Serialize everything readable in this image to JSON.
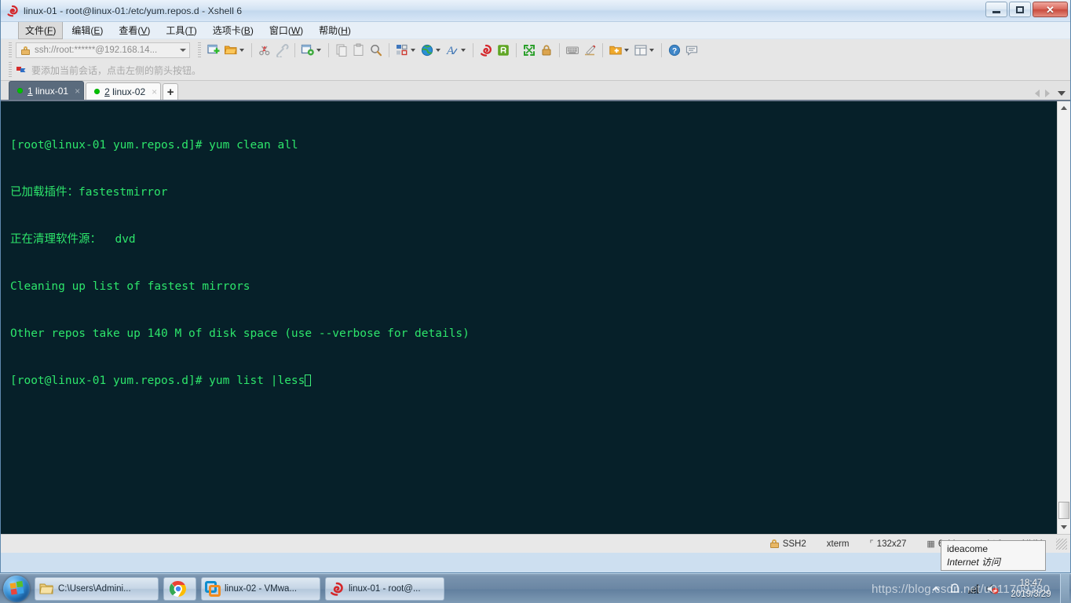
{
  "window": {
    "title": "linux-01 - root@linux-01:/etc/yum.repos.d - Xshell 6",
    "icon": "xshell-icon",
    "minimize_label": "–",
    "maximize_label": "□",
    "close_label": "✕"
  },
  "menu": [
    {
      "label_cn": "文件",
      "key": "F",
      "active": true
    },
    {
      "label_cn": "编辑",
      "key": "E",
      "active": false
    },
    {
      "label_cn": "查看",
      "key": "V",
      "active": false
    },
    {
      "label_cn": "工具",
      "key": "T",
      "active": false
    },
    {
      "label_cn": "选项卡",
      "key": "B",
      "active": false
    },
    {
      "label_cn": "窗口",
      "key": "W",
      "active": false
    },
    {
      "label_cn": "帮助",
      "key": "H",
      "active": false
    }
  ],
  "address_bar": {
    "value": "ssh://root:******@192.168.14...",
    "lock_icon": "lock-icon",
    "dropdown_icon": "chevron-down-icon"
  },
  "hint_bar": {
    "icon": "red-blue-flag-icon",
    "text": "要添加当前会话，点击左侧的箭头按钮。"
  },
  "toolbar": {
    "buttons": [
      {
        "name": "new-session-icon",
        "glyph": "➕"
      },
      {
        "name": "open-folder-icon",
        "glyph": "📁"
      },
      {
        "name": "disconnect-icon",
        "glyph": "✂"
      },
      {
        "name": "reconnect-icon",
        "glyph": "🔗"
      },
      {
        "name": "session-properties-icon",
        "glyph": "⚙"
      },
      {
        "name": "copy-icon",
        "glyph": "❐"
      },
      {
        "name": "paste-icon",
        "glyph": "❑"
      },
      {
        "name": "find-icon",
        "glyph": "🔍"
      },
      {
        "name": "layout-icon",
        "glyph": "▣"
      },
      {
        "name": "globe-icon",
        "glyph": "🌐"
      },
      {
        "name": "font-icon",
        "glyph": "A"
      },
      {
        "name": "xshell-icon",
        "glyph": "◉"
      },
      {
        "name": "xftp-icon",
        "glyph": "■"
      },
      {
        "name": "fullscreen-icon",
        "glyph": "⤢"
      },
      {
        "name": "lock-session-icon",
        "glyph": "🔒"
      },
      {
        "name": "keyboard-icon",
        "glyph": "⌨"
      },
      {
        "name": "compose-icon",
        "glyph": "✏"
      },
      {
        "name": "add-to-favorites-icon",
        "glyph": "➕"
      },
      {
        "name": "split-view-icon",
        "glyph": "◫"
      },
      {
        "name": "help-icon",
        "glyph": "?"
      },
      {
        "name": "feedback-icon",
        "glyph": "💬"
      }
    ]
  },
  "tabs": {
    "items": [
      {
        "index": "1",
        "label": "linux-01",
        "selected": true,
        "close_label": "×",
        "status": "connected"
      },
      {
        "index": "2",
        "label": "linux-02",
        "selected": false,
        "close_label": "×",
        "status": "connected"
      }
    ],
    "add_label": "+",
    "nav_prev_icon": "chevron-left-icon",
    "nav_next_icon": "chevron-right-icon",
    "nav_list_icon": "chevron-down-icon"
  },
  "terminal": {
    "lines": [
      {
        "segments": [
          {
            "text": "[root@linux-01 yum.repos.d]# yum clean all",
            "color": "green"
          }
        ]
      },
      {
        "segments": [
          {
            "text": "已加载插件：fastestmirror",
            "color": "green"
          }
        ]
      },
      {
        "segments": [
          {
            "text": "正在清理软件源：  dvd",
            "color": "green"
          }
        ]
      },
      {
        "segments": [
          {
            "text": "Cleaning up list of fastest mirrors",
            "color": "green"
          }
        ]
      },
      {
        "segments": [
          {
            "text": "Other repos take up 140 M of disk space (use --verbose for details)",
            "color": "green"
          }
        ]
      },
      {
        "segments": [
          {
            "text": "[root@linux-01 yum.repos.d]# yum list |less",
            "color": "green"
          }
        ],
        "cursor": true
      }
    ],
    "background": "#062029",
    "foreground": "#2de56b",
    "scrollbar": {
      "up_icon": "scroll-up-icon",
      "down_icon": "scroll-down-icon"
    }
  },
  "status_bar": {
    "lock_icon": "lock-icon",
    "protocol": "SSH2",
    "terminal_type": "xterm",
    "size_icon": "terminal-size-icon",
    "size": "132x27",
    "cursor_icon": "cursor-position-icon",
    "cursor_position": "6,44",
    "sessions": "2 会话",
    "num_lock": "NUM"
  },
  "network_balloon": {
    "line1": "ideacome",
    "line2": "Internet 访问"
  },
  "taskbar": {
    "start_icon": "windows-start-orb",
    "items": [
      {
        "icon": "folder-icon",
        "label": "C:\\Users\\Admini..."
      },
      {
        "icon": "chrome-icon",
        "label": ""
      },
      {
        "icon": "vmware-icon",
        "label": "linux-02 - VMwa..."
      },
      {
        "icon": "xshell-icon",
        "label": "linux-01 - root@..."
      }
    ],
    "tray": [
      {
        "icon": "show-hidden-icons-icon"
      },
      {
        "icon": "action-center-icon"
      },
      {
        "icon": "network-icon"
      },
      {
        "icon": "volume-muted-icon"
      }
    ],
    "clock_time": "18:47",
    "clock_date": "2019/3/29"
  },
  "watermark": {
    "text": "https://blog.csdn.net/u011709380"
  }
}
